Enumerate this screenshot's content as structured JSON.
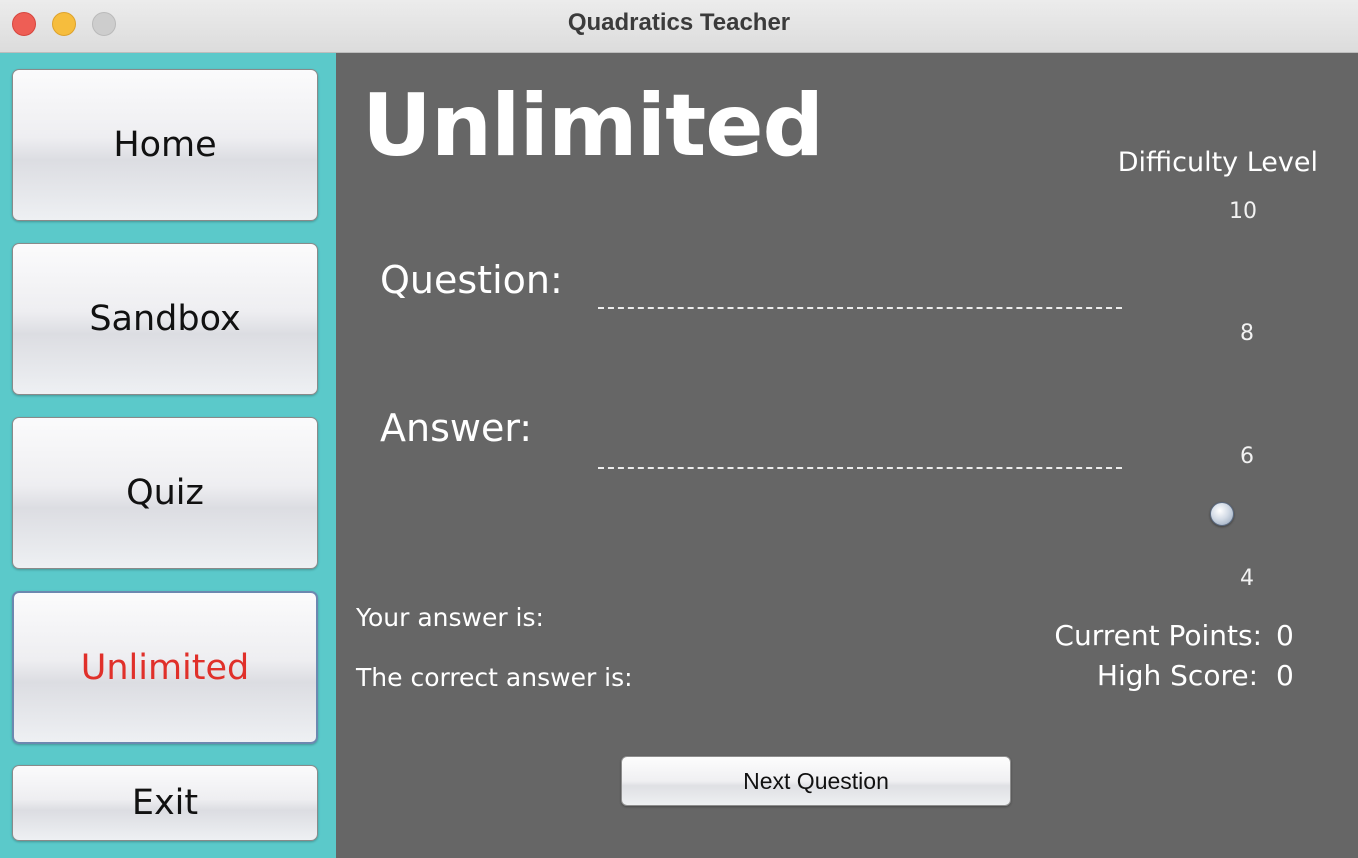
{
  "window": {
    "title": "Quadratics Teacher"
  },
  "sidebar": {
    "items": [
      {
        "label": "Home"
      },
      {
        "label": "Sandbox"
      },
      {
        "label": "Quiz"
      },
      {
        "label": "Unlimited",
        "active": true
      },
      {
        "label": "Exit"
      }
    ]
  },
  "main": {
    "heading": "Unlimited",
    "question_label": "Question:",
    "answer_label": "Answer:",
    "your_answer_label": "Your answer is:",
    "correct_answer_label": "The correct answer is:",
    "difficulty": {
      "title": "Difficulty Level",
      "ticks": [
        "10",
        "8",
        "6",
        "4"
      ],
      "value": 5
    },
    "score": {
      "current_label": "Current Points:",
      "current_value": "0",
      "high_label": "High Score:",
      "high_value": "0"
    },
    "next_button": "Next Question"
  },
  "colors": {
    "sidebar_bg": "#5bc9ca",
    "main_bg": "#666666",
    "active_text": "#e0302a"
  }
}
